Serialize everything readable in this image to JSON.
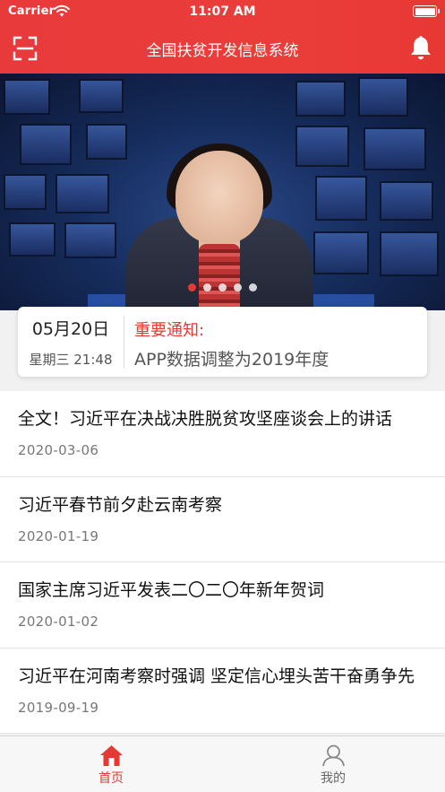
{
  "status_bar": {
    "carrier": "Carrier",
    "time": "11:07 AM"
  },
  "header": {
    "title": "全国扶贫开发信息系统",
    "left_icon": "scan-icon",
    "right_icon": "bell-icon"
  },
  "banner": {
    "slide_count": 5,
    "active_slide": 1
  },
  "notice": {
    "date": "05月20日",
    "weekday_time": "星期三 21:48",
    "heading": "重要通知:",
    "text": "APP数据调整为2019年度"
  },
  "news": [
    {
      "title": "全文！习近平在决战决胜脱贫攻坚座谈会上的讲话",
      "date": "2020-03-06"
    },
    {
      "title": "习近平春节前夕赴云南考察",
      "date": "2020-01-19"
    },
    {
      "title": "国家主席习近平发表二〇二〇年新年贺词",
      "date": "2020-01-02"
    },
    {
      "title": "习近平在河南考察时强调 坚定信心埋头苦干奋勇争先",
      "date": "2019-09-19"
    }
  ],
  "tabbar": {
    "home_label": "首页",
    "mine_label": "我的"
  },
  "colors": {
    "brand": "#e83a3a",
    "accent_text": "#e53935"
  }
}
